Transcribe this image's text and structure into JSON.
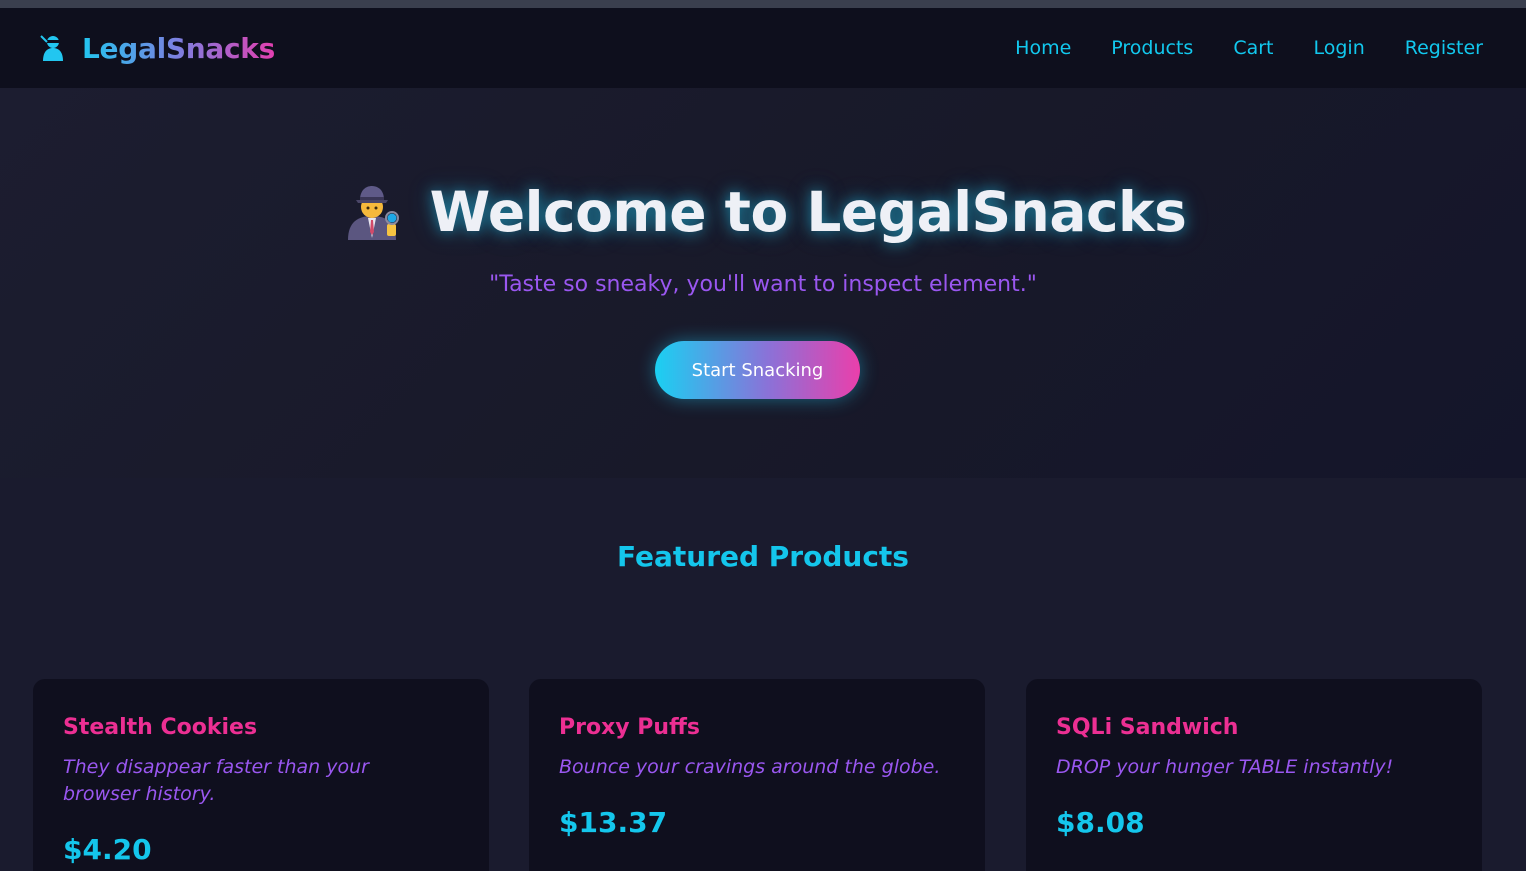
{
  "brand": {
    "name": "LegalSnacks",
    "icon": "ninja-icon"
  },
  "nav": {
    "links": [
      {
        "label": "Home"
      },
      {
        "label": "Products"
      },
      {
        "label": "Cart"
      },
      {
        "label": "Login"
      },
      {
        "label": "Register"
      }
    ]
  },
  "hero": {
    "title": "Welcome to LegalSnacks",
    "title_icon": "detective-icon",
    "tagline": "\"Taste so sneaky, you'll want to inspect element.\"",
    "cta_label": "Start Snacking"
  },
  "featured": {
    "heading": "Featured Products",
    "products": [
      {
        "name": "Stealth Cookies",
        "description": "They disappear faster than your browser history.",
        "price": "$4.20"
      },
      {
        "name": "Proxy Puffs",
        "description": "Bounce your cravings around the globe.",
        "price": "$13.37"
      },
      {
        "name": "SQLi Sandwich",
        "description": "DROP your hunger TABLE instantly!",
        "price": "$8.08"
      }
    ]
  },
  "colors": {
    "page_bg": "#1a1b2e",
    "nav_bg": "#0e0f1d",
    "accent_cyan": "#14c6ec",
    "accent_pink": "#ec2f93",
    "accent_purple": "#9a57f0"
  }
}
